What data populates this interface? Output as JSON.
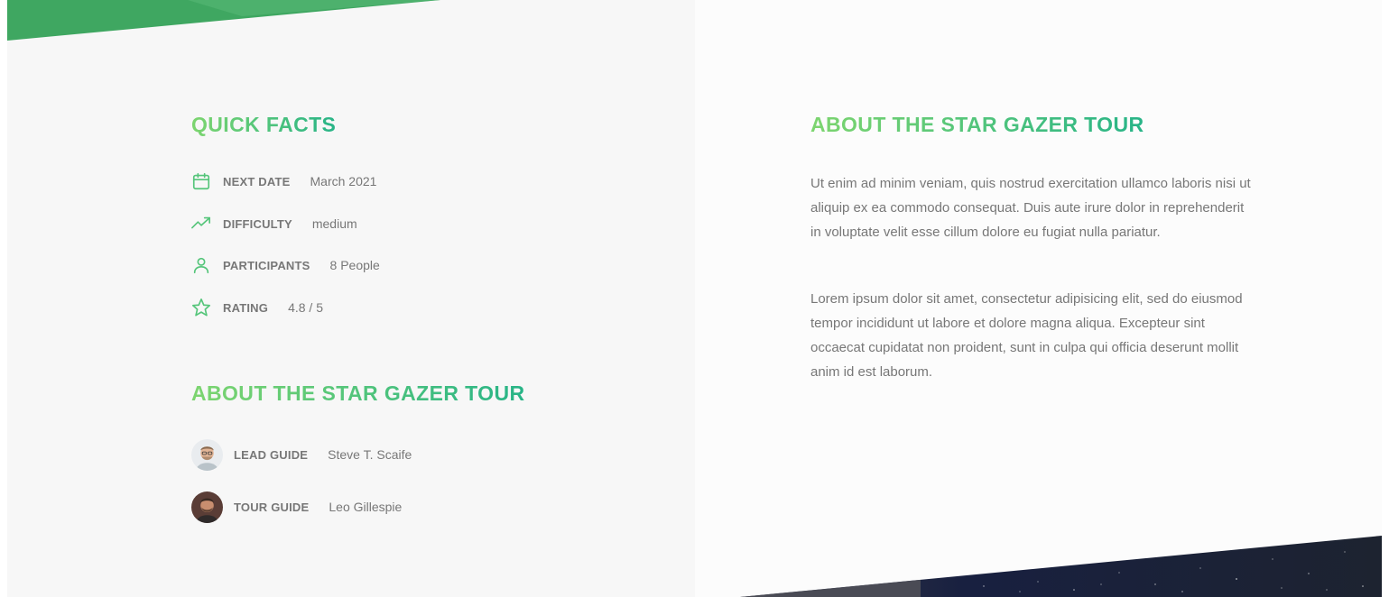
{
  "quick_facts": {
    "heading": "QUICK FACTS",
    "items": [
      {
        "icon": "calendar-icon",
        "label": "NEXT DATE",
        "value": "March 2021"
      },
      {
        "icon": "trending-up-icon",
        "label": "DIFFICULTY",
        "value": "medium"
      },
      {
        "icon": "user-icon",
        "label": "PARTICIPANTS",
        "value": "8 People"
      },
      {
        "icon": "star-icon",
        "label": "RATING",
        "value": "4.8 / 5"
      }
    ]
  },
  "guides": {
    "heading": "ABOUT THE STAR GAZER TOUR",
    "items": [
      {
        "role": "LEAD GUIDE",
        "name": "Steve T. Scaife"
      },
      {
        "role": "TOUR GUIDE",
        "name": "Leo Gillespie"
      }
    ]
  },
  "description": {
    "heading": "ABOUT THE STAR GAZER TOUR",
    "paragraphs": [
      "Ut enim ad minim veniam, quis nostrud exercitation ullamco laboris nisi ut aliquip ex ea commodo consequat. Duis aute irure dolor in reprehenderit in voluptate velit esse cillum dolore eu fugiat nulla pariatur.",
      "Lorem ipsum dolor sit amet, consectetur adipisicing elit, sed do eiusmod tempor incididunt ut labore et dolore magna aliqua. Excepteur sint occaecat cupidatat non proident, sunt in culpa qui officia deserunt mollit anim id est laborum."
    ]
  },
  "colors": {
    "accent_start": "#7dd56f",
    "accent_end": "#28b487",
    "text": "#777777",
    "left_bg": "#f7f7f7",
    "right_bg": "#fcfcfc"
  }
}
